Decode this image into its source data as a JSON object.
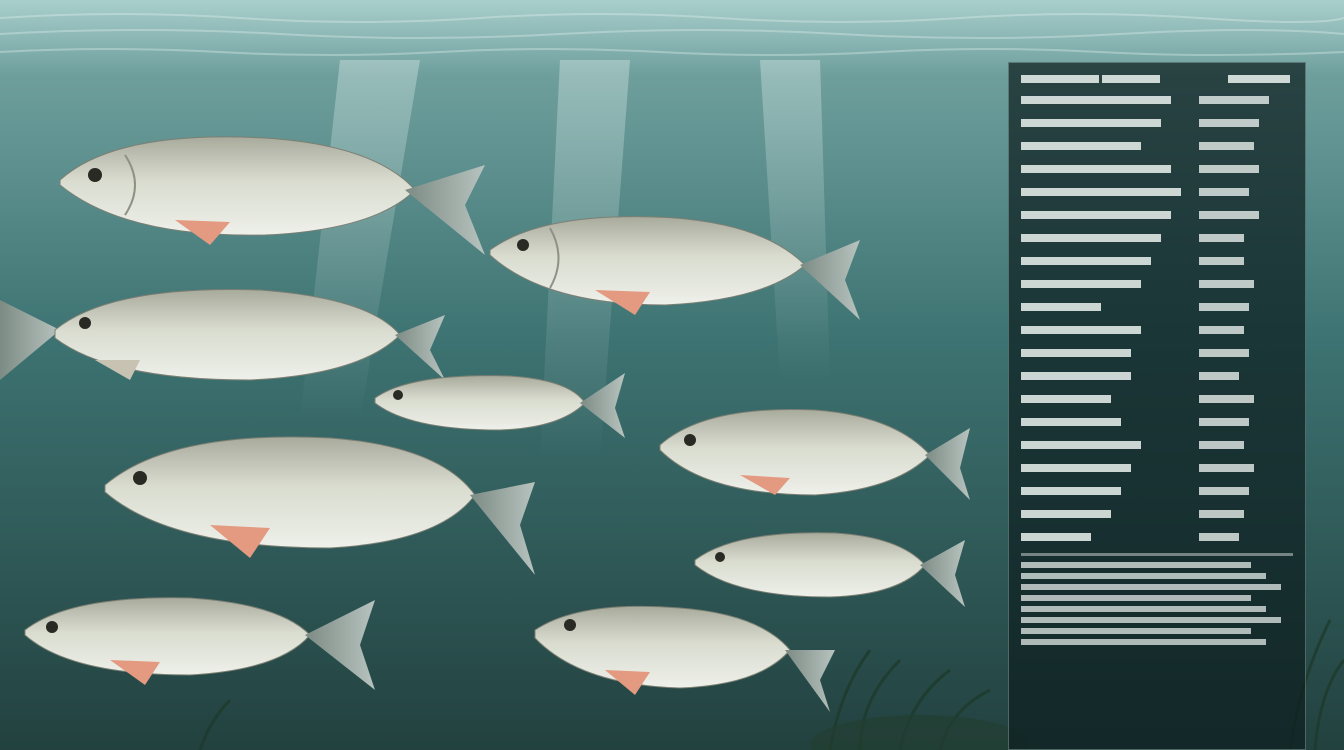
{
  "scene": {
    "description_colors": {
      "water_top": "#9cc3c1",
      "water_mid": "#3f7574",
      "water_bottom": "#274a47",
      "fish_body": "#cfd3c9",
      "fish_fin": "#e39a80"
    }
  },
  "panel": {
    "header_left": "",
    "header_right": "",
    "rows": [
      {
        "l": "",
        "r": ""
      },
      {
        "l": "",
        "r": ""
      },
      {
        "l": "",
        "r": ""
      },
      {
        "l": "",
        "r": ""
      },
      {
        "l": "",
        "r": ""
      },
      {
        "l": "",
        "r": ""
      },
      {
        "l": "",
        "r": ""
      },
      {
        "l": "",
        "r": ""
      },
      {
        "l": "",
        "r": ""
      },
      {
        "l": "",
        "r": ""
      },
      {
        "l": "",
        "r": ""
      },
      {
        "l": "",
        "r": ""
      },
      {
        "l": "",
        "r": ""
      },
      {
        "l": "",
        "r": ""
      },
      {
        "l": "",
        "r": ""
      },
      {
        "l": "",
        "r": ""
      },
      {
        "l": "",
        "r": ""
      },
      {
        "l": "",
        "r": ""
      },
      {
        "l": "",
        "r": ""
      },
      {
        "l": "",
        "r": ""
      }
    ],
    "footer": [
      "",
      "",
      "",
      "",
      "",
      "",
      "",
      ""
    ]
  }
}
